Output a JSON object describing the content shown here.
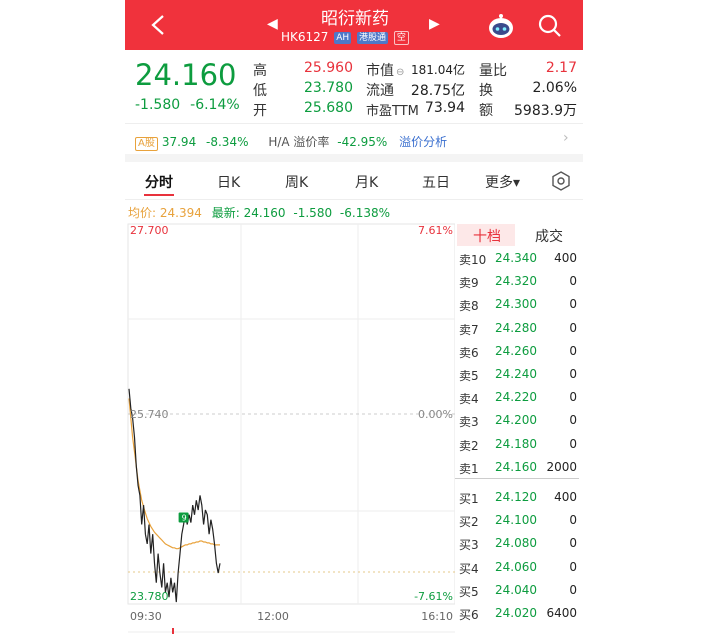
{
  "header": {
    "title": "昭衍新药",
    "code": "HK6127",
    "tags": [
      "AH",
      "港股通",
      "空"
    ],
    "prev_symbol": "◀",
    "next_symbol": "▶",
    "back_icon": "chevron-left-icon",
    "robot_icon": "robot-icon",
    "search_icon": "search-icon",
    "bg_color": "#f0323c"
  },
  "quote": {
    "price": "24.160",
    "change": "-1.580",
    "change_pct": "-6.14%",
    "stats": [
      {
        "label": "高",
        "value": "25.960",
        "color": "red"
      },
      {
        "label": "低",
        "value": "23.780",
        "color": "green"
      },
      {
        "label": "开",
        "value": "25.680",
        "color": "green"
      },
      {
        "label": "市值",
        "value": "181.04亿",
        "color": "dark"
      },
      {
        "label": "流通",
        "value": "28.75亿",
        "color": "dark"
      },
      {
        "label": "市盈TTM",
        "value": "73.94",
        "color": "dark"
      },
      {
        "label": "量比",
        "value": "2.17",
        "color": "red"
      },
      {
        "label": "换",
        "value": "2.06%",
        "color": "dark"
      },
      {
        "label": "额",
        "value": "5983.9万",
        "color": "dark"
      }
    ]
  },
  "ah_bar": {
    "tag": "A股",
    "a_price": "37.94",
    "a_change": "-8.34%",
    "premium_label": "H/A 溢价率",
    "premium": "-42.95%",
    "link": "溢价分析"
  },
  "tabs": [
    "分时",
    "日K",
    "周K",
    "月K",
    "五日",
    "更多▾"
  ],
  "tab_settings_icon": "hexagon-settings-icon",
  "avg_line": {
    "avg_label": "均价:",
    "avg_value": "24.394",
    "latest_label": "最新:",
    "latest_value": "24.160",
    "latest_change": "-1.580",
    "latest_pct": "-6.138%"
  },
  "chart_data": {
    "type": "line",
    "y_top_label": "27.700",
    "y_mid_label": "25.740",
    "y_bottom_label": "23.780",
    "pct_top_label": "7.61%",
    "pct_mid_label": "0.00%",
    "pct_bottom_label": "-7.61%",
    "x_labels": [
      "09:30",
      "12:00",
      "16:10"
    ],
    "ylim": [
      23.78,
      27.7
    ],
    "prev_close": 25.74,
    "marker_label": "9",
    "price_series": [
      26.0,
      25.8,
      25.7,
      25.5,
      25.2,
      25.0,
      24.9,
      24.6,
      24.8,
      24.5,
      24.4,
      24.6,
      24.3,
      24.5,
      24.2,
      24.0,
      24.3,
      24.1,
      23.95,
      24.2,
      23.9,
      24.0,
      23.85,
      24.05,
      23.9,
      24.0,
      23.8,
      24.1,
      24.3,
      24.5,
      24.6,
      24.72,
      24.6,
      24.7,
      24.62,
      24.8,
      24.7,
      24.85,
      24.75,
      24.9,
      24.8,
      24.6,
      24.75,
      24.7,
      24.5,
      24.65,
      24.55,
      24.4,
      24.2,
      24.1,
      24.2
    ],
    "avg_series": [
      25.9,
      25.7,
      25.5,
      25.35,
      25.2,
      25.05,
      24.95,
      24.85,
      24.78,
      24.72,
      24.66,
      24.62,
      24.58,
      24.55,
      24.52,
      24.5,
      24.48,
      24.46,
      24.44,
      24.42,
      24.4,
      24.39,
      24.38,
      24.37,
      24.36,
      24.36,
      24.35,
      24.35,
      24.36,
      24.37,
      24.38,
      24.39,
      24.39,
      24.4,
      24.4,
      24.41,
      24.41,
      24.42,
      24.42,
      24.43,
      24.43,
      24.42,
      24.42,
      24.41,
      24.41,
      24.4,
      24.4,
      24.39,
      24.39,
      24.39,
      24.39
    ]
  },
  "orderbook": {
    "tabs": [
      "十档",
      "成交"
    ],
    "sell": [
      {
        "label": "卖10",
        "price": "24.340",
        "vol": "400"
      },
      {
        "label": "卖9",
        "price": "24.320",
        "vol": "0"
      },
      {
        "label": "卖8",
        "price": "24.300",
        "vol": "0"
      },
      {
        "label": "卖7",
        "price": "24.280",
        "vol": "0"
      },
      {
        "label": "卖6",
        "price": "24.260",
        "vol": "0"
      },
      {
        "label": "卖5",
        "price": "24.240",
        "vol": "0"
      },
      {
        "label": "卖4",
        "price": "24.220",
        "vol": "0"
      },
      {
        "label": "卖3",
        "price": "24.200",
        "vol": "0"
      },
      {
        "label": "卖2",
        "price": "24.180",
        "vol": "0"
      },
      {
        "label": "卖1",
        "price": "24.160",
        "vol": "2000"
      }
    ],
    "buy": [
      {
        "label": "买1",
        "price": "24.120",
        "vol": "400"
      },
      {
        "label": "买2",
        "price": "24.100",
        "vol": "0"
      },
      {
        "label": "买3",
        "price": "24.080",
        "vol": "0"
      },
      {
        "label": "买4",
        "price": "24.060",
        "vol": "0"
      },
      {
        "label": "买5",
        "price": "24.040",
        "vol": "0"
      },
      {
        "label": "买6",
        "price": "24.020",
        "vol": "6400"
      }
    ]
  }
}
